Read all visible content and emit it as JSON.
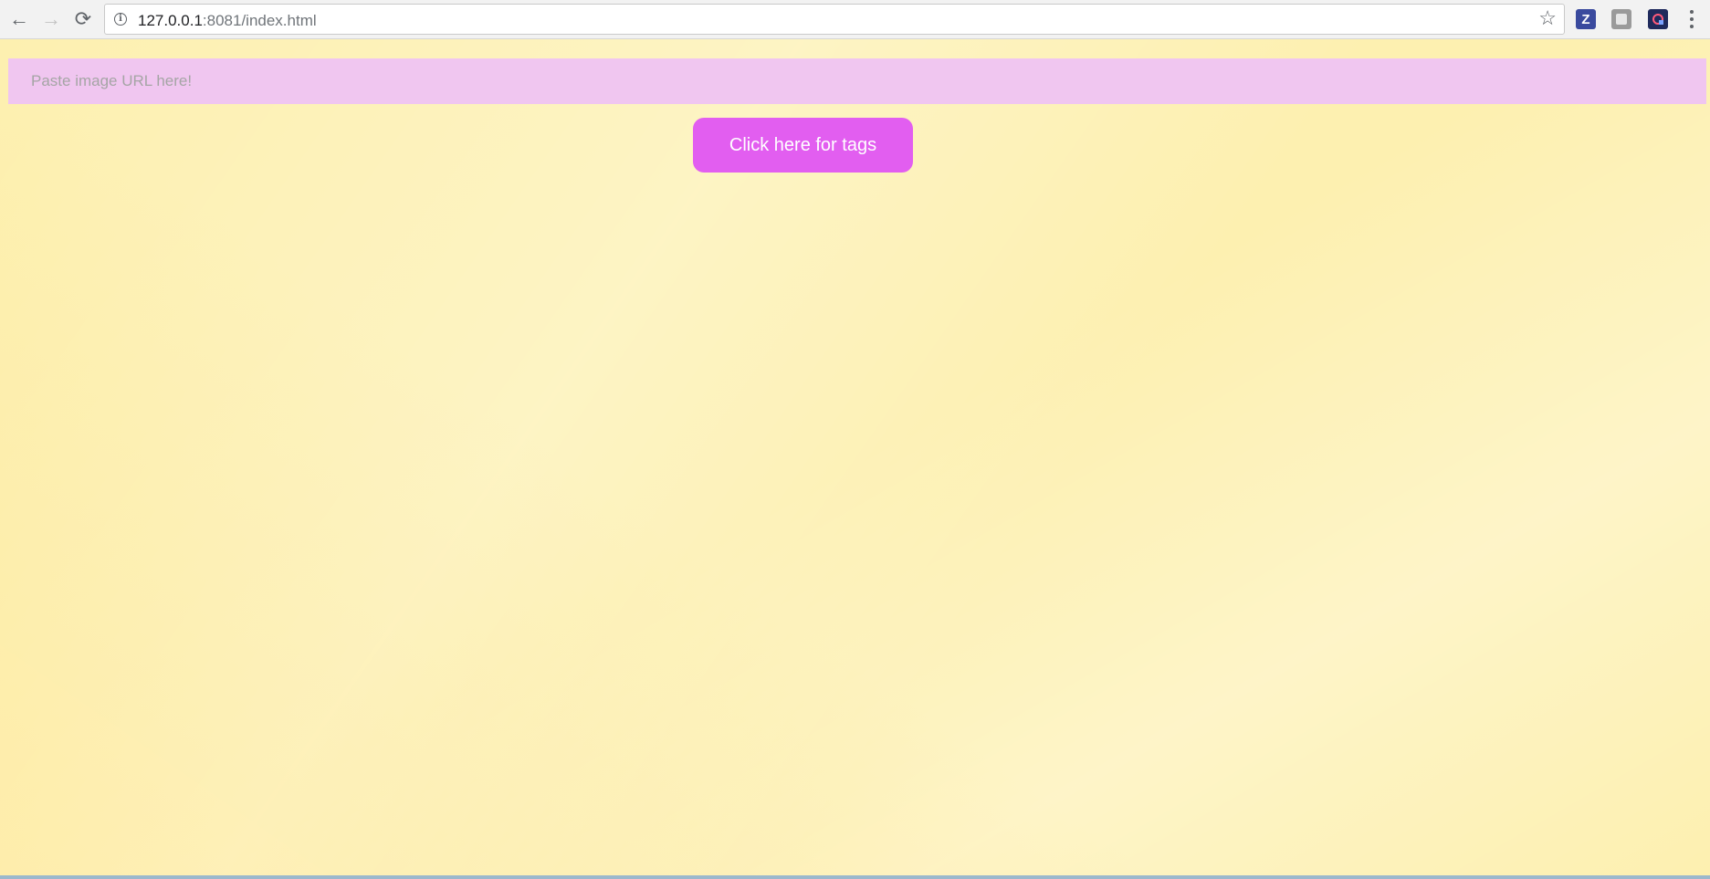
{
  "browser": {
    "back_icon": "←",
    "forward_icon": "→",
    "reload_icon": "⟳",
    "info_icon": "i",
    "url_host": "127.0.0.1",
    "url_rest": ":8081/index.html",
    "star_icon": "☆",
    "extensions": [
      {
        "name": "z-extension-icon",
        "glyph": "Z"
      },
      {
        "name": "gray-extension-icon",
        "glyph": ""
      },
      {
        "name": "dark-extension-icon",
        "glyph": ""
      }
    ]
  },
  "page": {
    "input_placeholder": "Paste image URL here!",
    "input_value": "",
    "button_label": "Click here for tags",
    "colors": {
      "background": "#fdf0b0",
      "input_bg": "#f0c6f0",
      "button_bg": "#e25ef0"
    }
  }
}
